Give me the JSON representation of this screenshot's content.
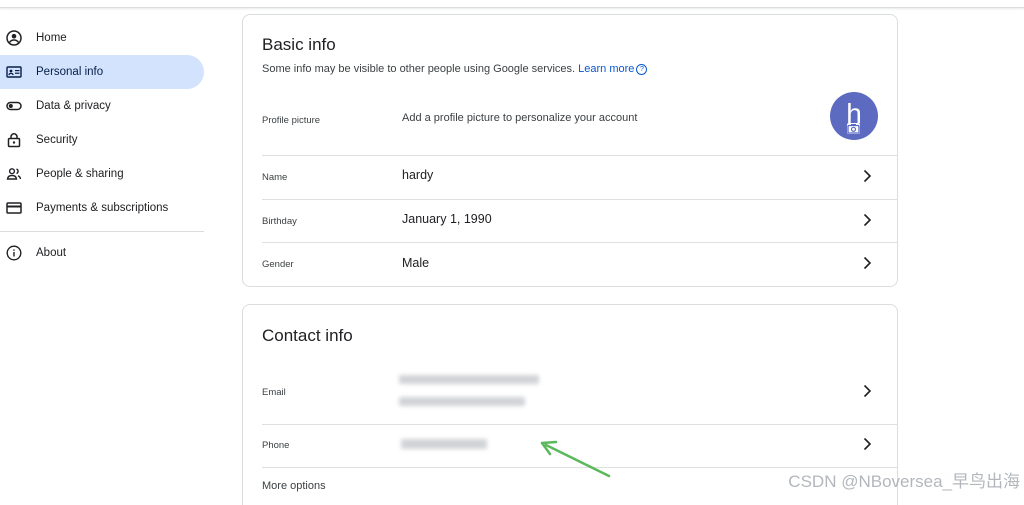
{
  "sidebar": {
    "items": [
      {
        "label": "Home",
        "icon": "account-circle-icon"
      },
      {
        "label": "Personal info",
        "icon": "id-card-icon",
        "active": true
      },
      {
        "label": "Data & privacy",
        "icon": "toggle-icon"
      },
      {
        "label": "Security",
        "icon": "lock-icon"
      },
      {
        "label": "People & sharing",
        "icon": "people-icon"
      },
      {
        "label": "Payments & subscriptions",
        "icon": "credit-card-icon"
      }
    ],
    "about": {
      "label": "About",
      "icon": "info-icon"
    }
  },
  "basic_info": {
    "title": "Basic info",
    "subtitle": "Some info may be visible to other people using Google services.",
    "learn_more": "Learn more",
    "profile_picture": {
      "label": "Profile picture",
      "value": "Add a profile picture to personalize your account",
      "avatar_letter": "h",
      "avatar_color": "#5c6bc0"
    },
    "name": {
      "label": "Name",
      "value": "hardy"
    },
    "birthday": {
      "label": "Birthday",
      "value": "January 1, 1990"
    },
    "gender": {
      "label": "Gender",
      "value": "Male"
    }
  },
  "contact_info": {
    "title": "Contact info",
    "email": {
      "label": "Email"
    },
    "phone": {
      "label": "Phone"
    },
    "more_options": "More options"
  },
  "watermark": "CSDN @NBoversea_早鸟出海",
  "colors": {
    "active_nav_bg": "#d3e3fd",
    "link": "#0b57d0",
    "arrow": "#5cb85c",
    "border": "#dadce0"
  }
}
